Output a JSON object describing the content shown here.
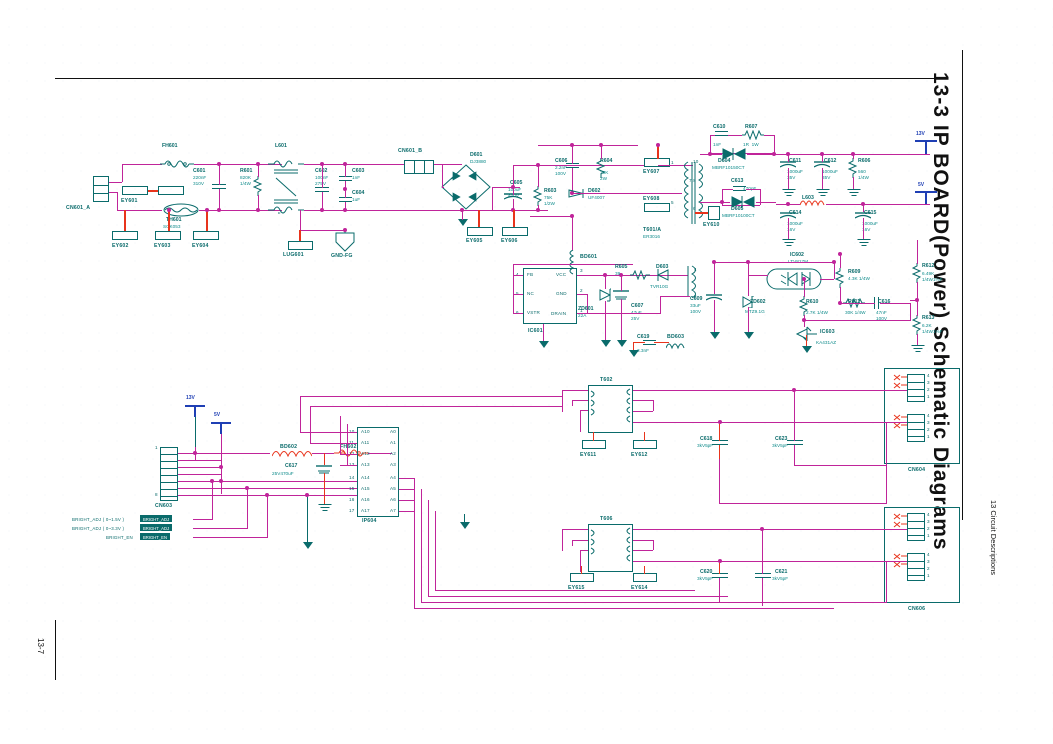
{
  "page": {
    "title": "13-3 IP BOARD(Power) Schematic Diagrams",
    "section_header": "13 Circuit Descriptions",
    "page_number": "13-7"
  },
  "colors": {
    "wire": "#c0249a",
    "component": "#0a6b6b",
    "value": "#0c8a8a",
    "rail": "#1f3fb4",
    "pad": "#e8341c"
  },
  "ac_input": {
    "connector": "CN601_A",
    "fuse": "FH601",
    "thermistor_ref": "TH601",
    "thermistor_part": "SCK053",
    "c601": {
      "ref": "C601",
      "value": "220nF\n310V"
    },
    "r601": {
      "ref": "R601",
      "value": "820K\n1/4W"
    },
    "earth_pads": [
      "EY601",
      "EY602",
      "EY603",
      "EY604"
    ],
    "line_filter": "L601",
    "c602": {
      "ref": "C602",
      "value": "100nF\n275V"
    },
    "c603": {
      "ref": "C603",
      "value": "1nF"
    },
    "c604": {
      "ref": "C604",
      "value": "1uF"
    },
    "lug": "LUG601",
    "gnd_fg": "GND-FG",
    "cn601_b": "CN601_B",
    "d601": {
      "ref": "D601",
      "value": "DJ3880"
    },
    "ey605": "EY605"
  },
  "primary": {
    "c605": {
      "ref": "C605",
      "value": "100uF\n400V"
    },
    "ey606": "EY606",
    "r603": {
      "ref": "R603",
      "value": "75K\n1/2W"
    },
    "c606": {
      "ref": "C606",
      "value": "2.2nF\n100V"
    },
    "r604": {
      "ref": "R604",
      "value": "39K\n2W"
    },
    "d602": {
      "ref": "D602",
      "value": "UF4007"
    },
    "bd601": "BD601",
    "ey607": "EY607",
    "ey608": "EY608",
    "transformer": {
      "ref": "T601/A",
      "value": "ER3016"
    },
    "ey610": "EY610",
    "ic601": {
      "ref": "IC601",
      "pins_left": [
        {
          "num": "4",
          "name": "FB"
        },
        {
          "num": "5",
          "name": "NC"
        },
        {
          "num": "6",
          "name": "VSTR"
        }
      ],
      "pins_right": [
        {
          "num": "3",
          "name": "VCC"
        },
        {
          "num": "2",
          "name": "GND"
        },
        {
          "num": "1",
          "name": "DRAIN"
        }
      ]
    },
    "zd601": {
      "ref": "ZD601",
      "value": "22A"
    },
    "c607": {
      "ref": "C607",
      "value": "47uF\n25V"
    },
    "r605": {
      "ref": "R605",
      "value": "39"
    },
    "d603": {
      "ref": "D603",
      "value": "TVR10G"
    },
    "c619": {
      "ref": "C619",
      "value": "3.3nF"
    },
    "bd603": "BD603",
    "tap_labels": [
      "10",
      "7,8",
      "6"
    ]
  },
  "secondary": {
    "c610": {
      "ref": "C610",
      "value": "1nF"
    },
    "r607": {
      "ref": "R607",
      "value": "1R  1W"
    },
    "d604": {
      "ref": "D604",
      "value": "MBRF10150CT"
    },
    "c611": {
      "ref": "C611",
      "value": "1000uF\n35V"
    },
    "c612": {
      "ref": "C612",
      "value": "1000uF\n35V"
    },
    "r606": {
      "ref": "R606",
      "value": "560\n1/4W"
    },
    "c613": {
      "ref": "C613",
      "value": "470pF"
    },
    "d605": {
      "ref": "D605",
      "value": "MBRF10100CT"
    },
    "l603": {
      "ref": "L603",
      "value": ""
    },
    "c614": {
      "ref": "C614",
      "value": "1000uF\n16V"
    },
    "c615": {
      "ref": "C615",
      "value": "1000uF\n16V"
    },
    "rail_13v": "13V",
    "rail_5v": "5V"
  },
  "feedback": {
    "c609": {
      "ref": "C609",
      "value": "33uF\n100V"
    },
    "zd602": {
      "ref": "ZD602",
      "value": "MTZ9.1G"
    },
    "ic602": {
      "ref": "IC602",
      "value": "LTV817M"
    },
    "r609": {
      "ref": "R609",
      "value": "4.3K 1/4W"
    },
    "r610": {
      "ref": "R610",
      "value": "2.7K 1/4W"
    },
    "r611": {
      "ref": "R611",
      "value": "30K 1/4W"
    },
    "c616": {
      "ref": "C616",
      "value": "47nF\n100V"
    },
    "ic603": {
      "ref": "IC603",
      "value": "KA431AZ"
    },
    "r612": {
      "ref": "R612",
      "value": "6.49K\n1/4W1%F"
    },
    "r613": {
      "ref": "R613",
      "value": "6.2K\n1/4W1%F"
    }
  },
  "inverter": {
    "cn603": "CN603",
    "bd602": "BD602",
    "fh602": "FH602",
    "c617": {
      "ref": "C617",
      "value": "25V470uF"
    },
    "rail_13v": "13V",
    "rail_5v": "5V",
    "ic604": "IP604",
    "bus_left": [
      "10",
      "11",
      "12",
      "13",
      "14",
      "15",
      "16",
      "17"
    ],
    "bus_a": [
      "A10",
      "A11",
      "A12",
      "A13",
      "A14",
      "A15",
      "A16",
      "A17"
    ],
    "bus_right": [
      "A0",
      "A1",
      "A2",
      "A3",
      "A4",
      "A5",
      "A6",
      "A7"
    ],
    "signals": [
      {
        "name": "BRIGHT_ADJ ( 0~1.5V )",
        "tag": "BRIGHT_ADJ"
      },
      {
        "name": "BRIGHT_ADJ ( 0~3.3V )",
        "tag": "BRIGHT_ADJ"
      },
      {
        "name": "BRIGHT_EN",
        "tag": "BRIGHT_EN"
      }
    ],
    "t602": "T602",
    "t606": "T606",
    "ey611": "EY611",
    "ey612": "EY612",
    "ey615": "EY615",
    "ey614": "EY614",
    "c618": {
      "ref": "C618",
      "value": "3kV5pF"
    },
    "c623": {
      "ref": "C623",
      "value": "3kV5pF"
    },
    "c620": {
      "ref": "C620",
      "value": "3kV5pF"
    },
    "c621": {
      "ref": "C621",
      "value": "3kV5pF"
    },
    "cn604": "CN604",
    "cn606": "CN606",
    "lamp_pins": [
      "4",
      "3",
      "2",
      "1"
    ]
  }
}
